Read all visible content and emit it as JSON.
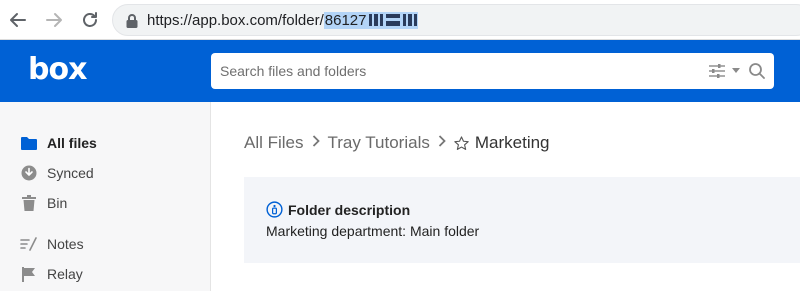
{
  "browser": {
    "url_base": "https://app.box.com/folder/",
    "url_selected": "86127"
  },
  "header": {
    "logo": "box",
    "search_placeholder": "Search files and folders"
  },
  "sidebar": {
    "items": [
      {
        "label": "All files",
        "icon": "folder-icon"
      },
      {
        "label": "Synced",
        "icon": "synced-icon"
      },
      {
        "label": "Bin",
        "icon": "bin-icon"
      },
      {
        "label": "Notes",
        "icon": "notes-icon"
      },
      {
        "label": "Relay",
        "icon": "relay-icon"
      }
    ]
  },
  "breadcrumb": {
    "items": [
      "All Files",
      "Tray Tutorials",
      "Marketing"
    ]
  },
  "folder_description": {
    "title": "Folder description",
    "text": "Marketing department: Main folder"
  },
  "colors": {
    "brand": "#0061d5",
    "sidebar_bg": "#f7f7f8",
    "desc_bg": "#f3f5f9"
  }
}
